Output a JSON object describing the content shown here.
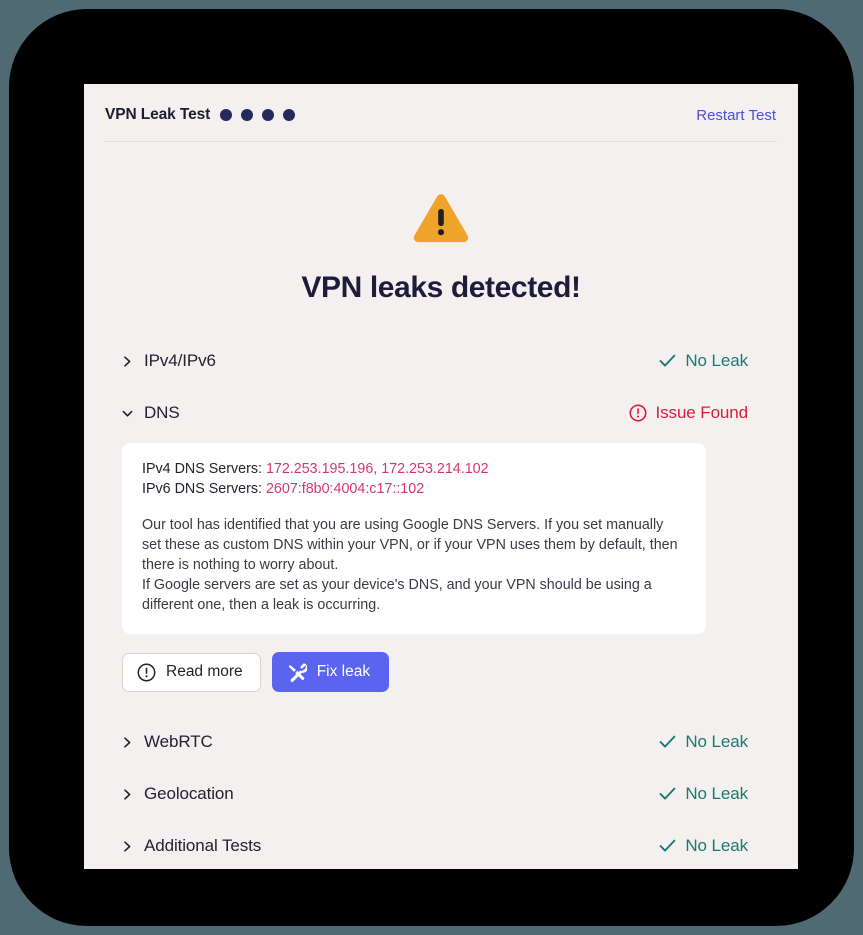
{
  "header": {
    "brand_title": "VPN Leak Test",
    "dots_count": 4,
    "dot_color": "#232a5c",
    "restart_label": "Restart Test",
    "restart_color": "#4a4ee0"
  },
  "hero": {
    "icon": "warning-triangle-icon",
    "icon_color": "#f0a32b",
    "title": "VPN leaks detected!"
  },
  "tests": [
    {
      "label": "IPv4/IPv6",
      "expanded": false,
      "chevron": "chevron-right-icon",
      "status": "No Leak",
      "status_type": "ok",
      "status_icon": "check-icon",
      "status_color": "#187a72"
    },
    {
      "label": "DNS",
      "expanded": true,
      "chevron": "chevron-down-icon",
      "status": "Issue Found",
      "status_type": "bad",
      "status_icon": "alert-circle-icon",
      "status_color": "#d61f3a"
    },
    {
      "label": "WebRTC",
      "expanded": false,
      "chevron": "chevron-right-icon",
      "status": "No Leak",
      "status_type": "ok",
      "status_icon": "check-icon",
      "status_color": "#187a72"
    },
    {
      "label": "Geolocation",
      "expanded": false,
      "chevron": "chevron-right-icon",
      "status": "No Leak",
      "status_type": "ok",
      "status_icon": "check-icon",
      "status_color": "#187a72"
    },
    {
      "label": "Additional Tests",
      "expanded": false,
      "chevron": "chevron-right-icon",
      "status": "No Leak",
      "status_type": "ok",
      "status_icon": "check-icon",
      "status_color": "#187a72"
    }
  ],
  "dns_detail": {
    "ipv4_label": "IPv4 DNS Servers:",
    "ipv4_value": "172.253.195.196, 172.253.214.102",
    "ipv6_label": "IPv6 DNS Servers:",
    "ipv6_value": "2607:f8b0:4004:c17::102",
    "value_color": "#d6376a",
    "note_line_1": "Our tool has identified that you are using Google DNS Servers. If you set manually set these as custom DNS within your VPN, or if your VPN uses them by default, then there is nothing to worry about.",
    "note_line_2": "If Google servers are set as your device's DNS, and your VPN should be using a different one, then a leak is occurring.",
    "buttons": {
      "read_more_label": "Read more",
      "read_more_icon": "alert-circle-icon",
      "fix_leak_label": "Fix leak",
      "fix_leak_icon": "hammer-wrench-icon",
      "fix_leak_color": "#5a64ef"
    }
  },
  "theme": {
    "backdrop": "#4f6a72",
    "frame": "#000000",
    "card_bg": "#f4f0ef",
    "panel_bg": "#ffffff",
    "title_color": "#1c1d3a"
  }
}
